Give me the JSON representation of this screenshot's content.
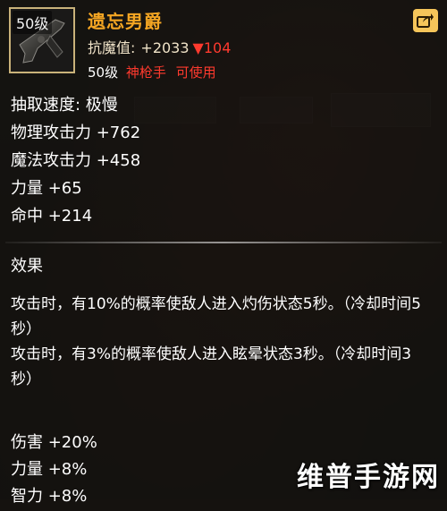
{
  "item": {
    "level_badge": "50级",
    "name": "遗忘男爵",
    "resist_label": "抗魔值:",
    "resist_value": "+2033",
    "resist_delta": "▼104",
    "req_level": "50级",
    "req_class": "神枪手",
    "req_usable": "可使用",
    "share_icon": "share-icon"
  },
  "stats": [
    "抽取速度: 极慢",
    "物理攻击力 +762",
    "魔法攻击力 +458",
    "力量 +65",
    "命中 +214"
  ],
  "effects": {
    "title": "效果",
    "lines": [
      "攻击时，有10%的概率使敌人进入灼伤状态5秒。（冷却时间5秒）",
      "攻击时，有3%的概率使敌人进入眩晕状态3秒。（冷却时间3秒）"
    ]
  },
  "bonuses": [
    "伤害 +20%",
    "力量 +8%",
    "智力 +8%"
  ],
  "watermark": "维普手游网",
  "colors": {
    "item_name": "#f5a623",
    "highlight_red": "#ff3a2e",
    "icon_border": "#c9b27a",
    "share_button": "#f5c55a"
  }
}
